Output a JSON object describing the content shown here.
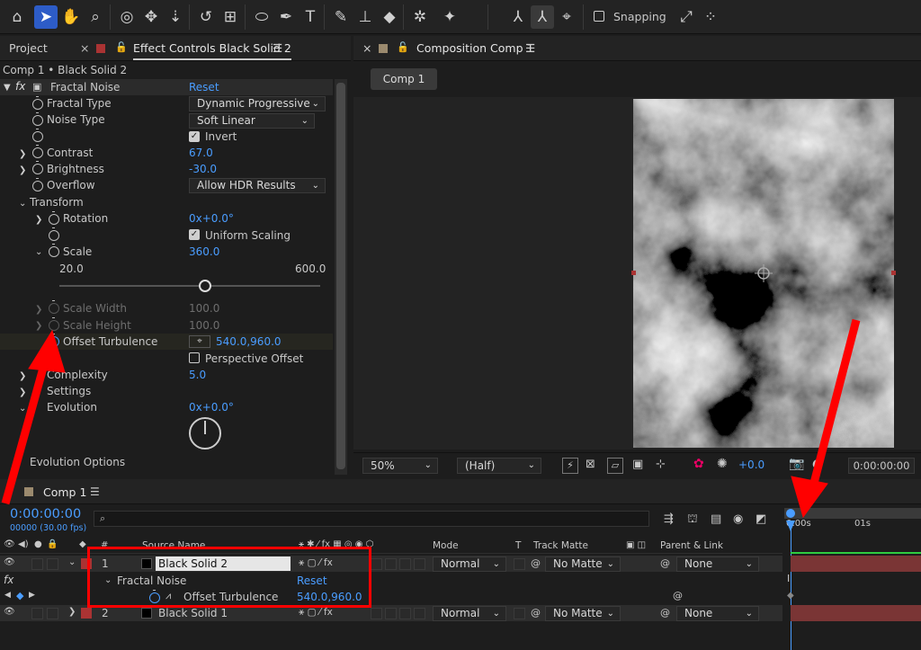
{
  "toolbar": {
    "tools": [
      "home-icon",
      "selection-arrow-icon",
      "hand-icon",
      "zoom-icon",
      "orbit-camera-icon",
      "pan-camera-icon",
      "dolly-camera-icon",
      "rotate-icon",
      "pan-behind-icon",
      "ellipse-icon",
      "pen-icon",
      "text-icon",
      "brush-icon",
      "clone-stamp-icon",
      "eraser-icon",
      "roto-brush-icon",
      "puppet-pin-icon"
    ],
    "axis_tools": [
      "local-axis-icon",
      "world-axis-icon",
      "view-axis-icon"
    ],
    "snapping_label": "Snapping"
  },
  "left_tabs": {
    "project": "Project",
    "effect_controls": "Effect Controls Black Solid 2"
  },
  "effect": {
    "breadcrumb": "Comp 1 • Black Solid 2",
    "fx": "fx",
    "name": "Fractal Noise",
    "reset": "Reset",
    "fractal_type_label": "Fractal Type",
    "fractal_type_value": "Dynamic Progressive",
    "noise_type_label": "Noise Type",
    "noise_type_value": "Soft Linear",
    "invert_label": "Invert",
    "contrast_label": "Contrast",
    "contrast_value": "67.0",
    "brightness_label": "Brightness",
    "brightness_value": "-30.0",
    "overflow_label": "Overflow",
    "overflow_value": "Allow HDR Results",
    "transform_label": "Transform",
    "rotation_label": "Rotation",
    "rotation_value": "0x+0.0°",
    "uniform_scaling_label": "Uniform Scaling",
    "scale_label": "Scale",
    "scale_value": "360.0",
    "scale_min": "20.0",
    "scale_max": "600.0",
    "scale_slider": 0.56,
    "scale_width_label": "Scale Width",
    "scale_width_value": "100.0",
    "scale_height_label": "Scale Height",
    "scale_height_value": "100.0",
    "offset_label": "Offset Turbulence",
    "offset_value": "540.0,960.0",
    "perspective_label": "Perspective Offset",
    "complexity_label": "Complexity",
    "complexity_value": "5.0",
    "sub_settings_label": "Settings",
    "evolution_label": "Evolution",
    "evolution_value": "0x+0.0°",
    "evolution_options_label": "Evolution Options"
  },
  "comp_tabs": {
    "composition": "Composition Comp 1",
    "comp_button": "Comp 1"
  },
  "comp_footer": {
    "zoom": "50%",
    "resolution": "(Half)",
    "exposure": "+0.0",
    "timecode": "0:00:00:00"
  },
  "timeline": {
    "tab": "Comp 1",
    "timecode": "0:00:00:00",
    "frames": "00000 (30.00 fps)",
    "ruler_0": "0:00s",
    "ruler_1": "01s",
    "headers": {
      "source_name": "Source Name",
      "mode": "Mode",
      "t": "T",
      "track_matte": "Track Matte",
      "parent": "Parent & Link"
    },
    "layers": [
      {
        "num": "1",
        "name": "Black Solid 2",
        "mode": "Normal",
        "matte": "No Matte",
        "parent": "None"
      },
      {
        "num": "2",
        "name": "Black Solid 1",
        "mode": "Normal",
        "matte": "No Matte",
        "parent": "None"
      }
    ],
    "sub_effect": "Fractal Noise",
    "sub_reset": "Reset",
    "sub_prop": "Offset Turbulence",
    "sub_value": "540.0,960.0",
    "fx": "fx"
  },
  "colors": {
    "accent": "#2d5cc7",
    "value_blue": "#4a9dff",
    "annotation_red": "#ff0000",
    "layer_bar": "#7a3535"
  }
}
